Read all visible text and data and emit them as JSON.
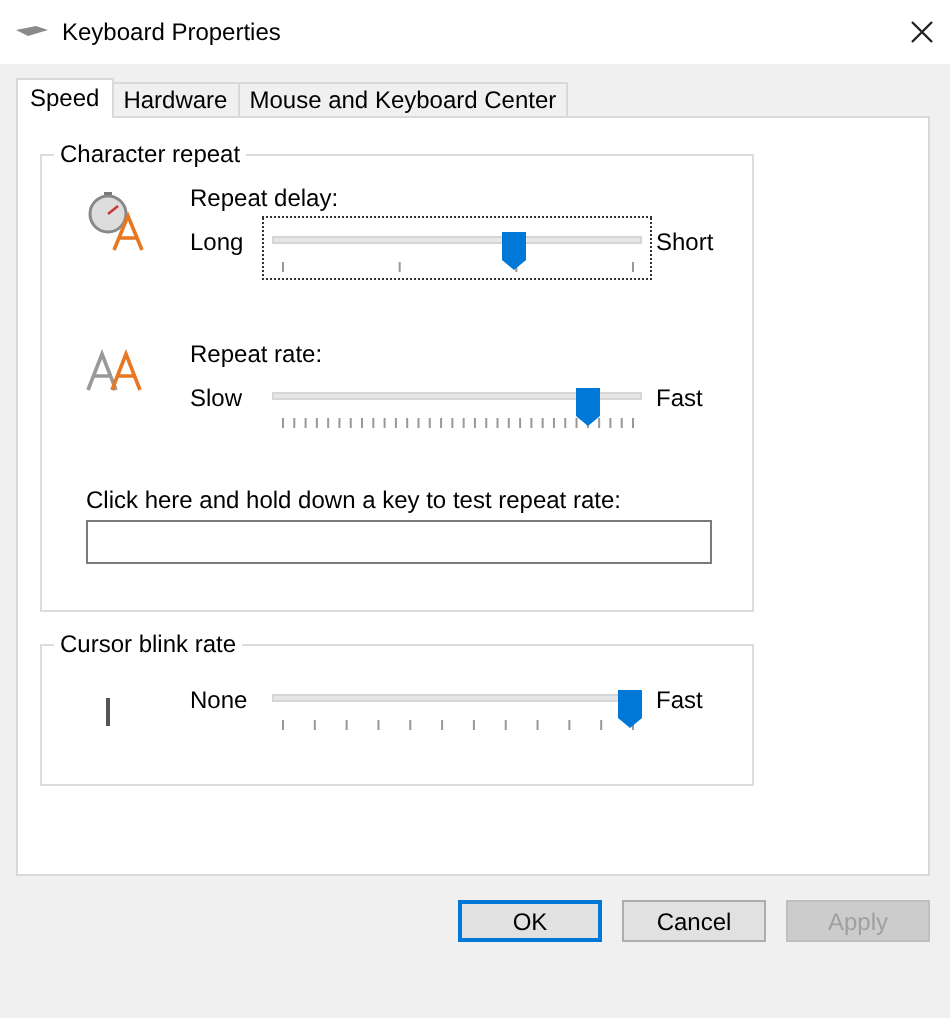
{
  "window": {
    "title": "Keyboard Properties"
  },
  "tabs": [
    {
      "label": "Speed",
      "selected": true
    },
    {
      "label": "Hardware",
      "selected": false
    },
    {
      "label": "Mouse and Keyboard Center",
      "selected": false
    }
  ],
  "groups": [
    {
      "title": "Character repeat",
      "sliders": [
        {
          "kind": "delay",
          "label": "Repeat delay:",
          "min_label": "Long",
          "max_label": "Short",
          "level": 0.667,
          "focused": true
        },
        {
          "kind": "rate",
          "label": "Repeat rate:",
          "min_label": "Slow",
          "max_label": "Fast",
          "level": 0.88,
          "focused": false
        }
      ],
      "test": {
        "label": "Click here and hold down a key to test repeat rate:"
      }
    },
    {
      "title": "Cursor blink rate",
      "sliders": [
        {
          "kind": "blink",
          "min_label": "None",
          "max_label": "Fast",
          "level": 1,
          "focused": false
        }
      ]
    }
  ],
  "buttons": [
    {
      "label": "OK",
      "default": true,
      "disabled": false
    },
    {
      "label": "Cancel",
      "default": false,
      "disabled": false
    },
    {
      "label": "Apply",
      "default": false,
      "disabled": true
    }
  ]
}
